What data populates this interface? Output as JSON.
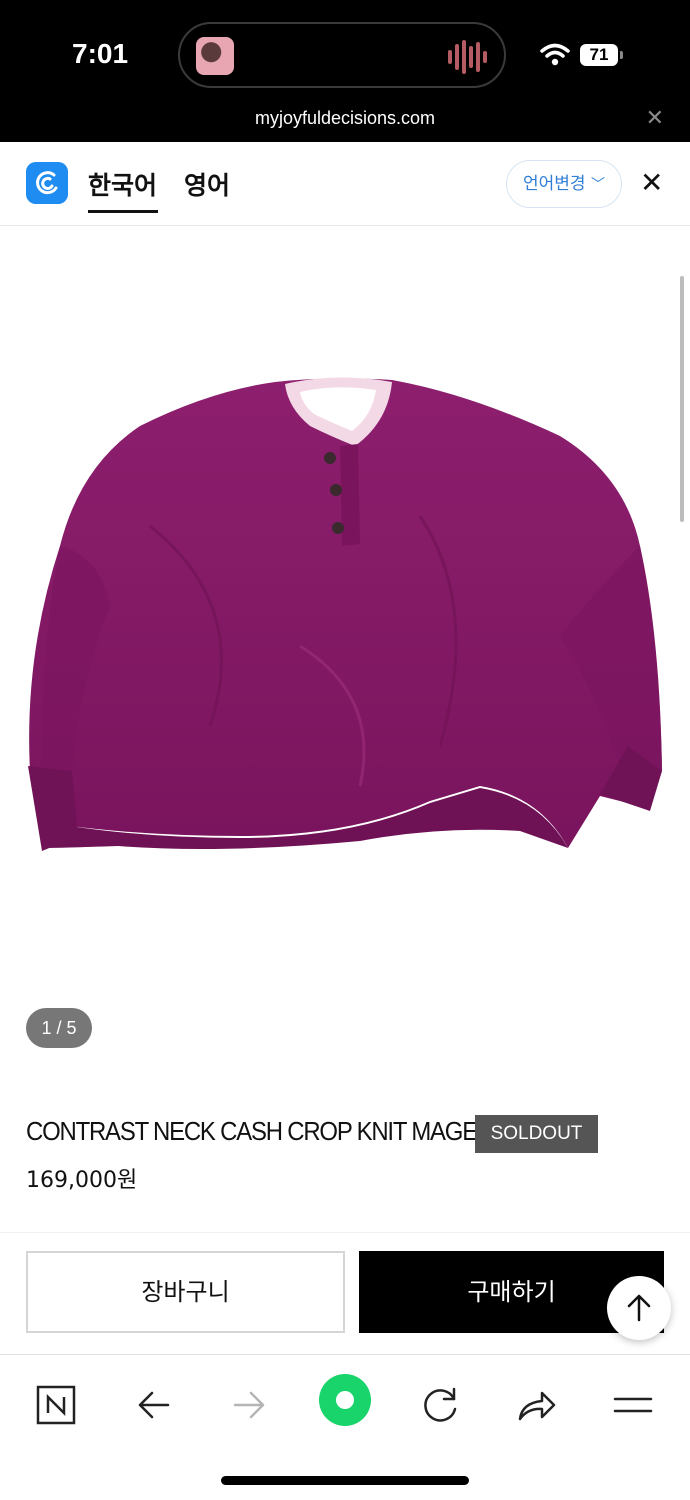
{
  "status_bar": {
    "time": "7:01",
    "battery": "71"
  },
  "browser": {
    "url": "myjoyfuldecisions.com"
  },
  "translate_bar": {
    "tabs": [
      {
        "label": "한국어",
        "active": true
      },
      {
        "label": "영어",
        "active": false
      }
    ],
    "language_button": "언어변경",
    "colors": {
      "accent": "#2f7fd6",
      "logo": "#1e8cf0"
    }
  },
  "product": {
    "image_counter": "1 / 5",
    "title": "CONTRAST NECK CASH CROP KNIT MAGENTA",
    "badge": "SOLDOUT",
    "price": "169,000원",
    "color_hex": "#8c1d6c"
  },
  "actions": {
    "cart_label": "장바구니",
    "buy_label": "구매하기"
  },
  "bottom_nav": {
    "items": [
      "n-home-icon",
      "back-arrow-icon",
      "forward-arrow-icon",
      "green-dot-icon",
      "reload-icon",
      "share-icon",
      "menu-icon"
    ],
    "accent": "#19d46b"
  }
}
